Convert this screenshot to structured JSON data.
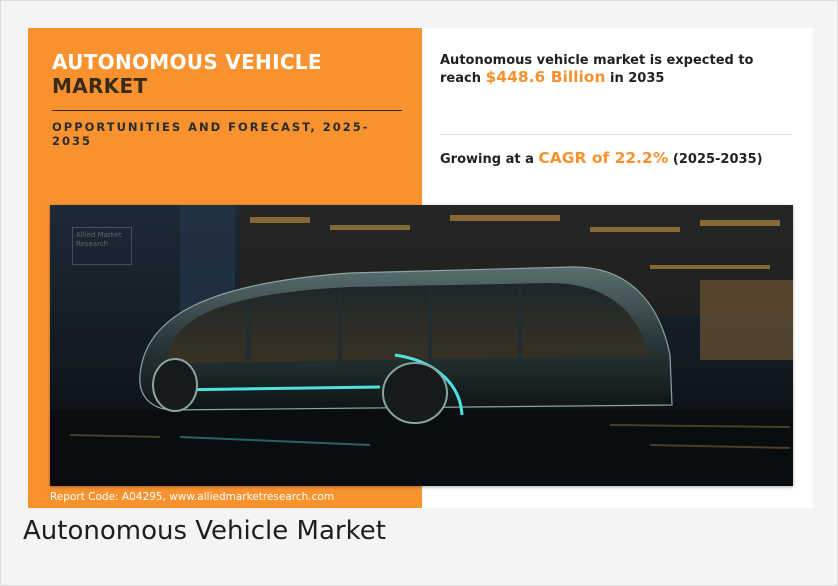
{
  "infographic": {
    "title_line1": "AUTONOMOUS VEHICLE",
    "title_line2": "MARKET",
    "subtitle": "OPPORTUNITIES AND FORECAST, 2025-2035",
    "stat1": {
      "prefix": "Autonomous vehicle market is expected to reach ",
      "value": "$448.6 Billion",
      "suffix": " in 2035"
    },
    "stat2": {
      "prefix": "Growing at a ",
      "value": "CAGR of 22.2%",
      "suffix": " (2025-2035)"
    },
    "watermark_text": "Allied Market Research",
    "report_code": "Report Code: A04295, www.alliedmarketresearch.com"
  },
  "caption": "Autonomous Vehicle Market",
  "colors": {
    "accent_orange": "#f7922f",
    "dark_text": "#222222",
    "title_dark": "#3a2a1a",
    "teal_glow": "#4fe3e0"
  },
  "image": {
    "subject": "futuristic-autonomous-bus-icon"
  }
}
